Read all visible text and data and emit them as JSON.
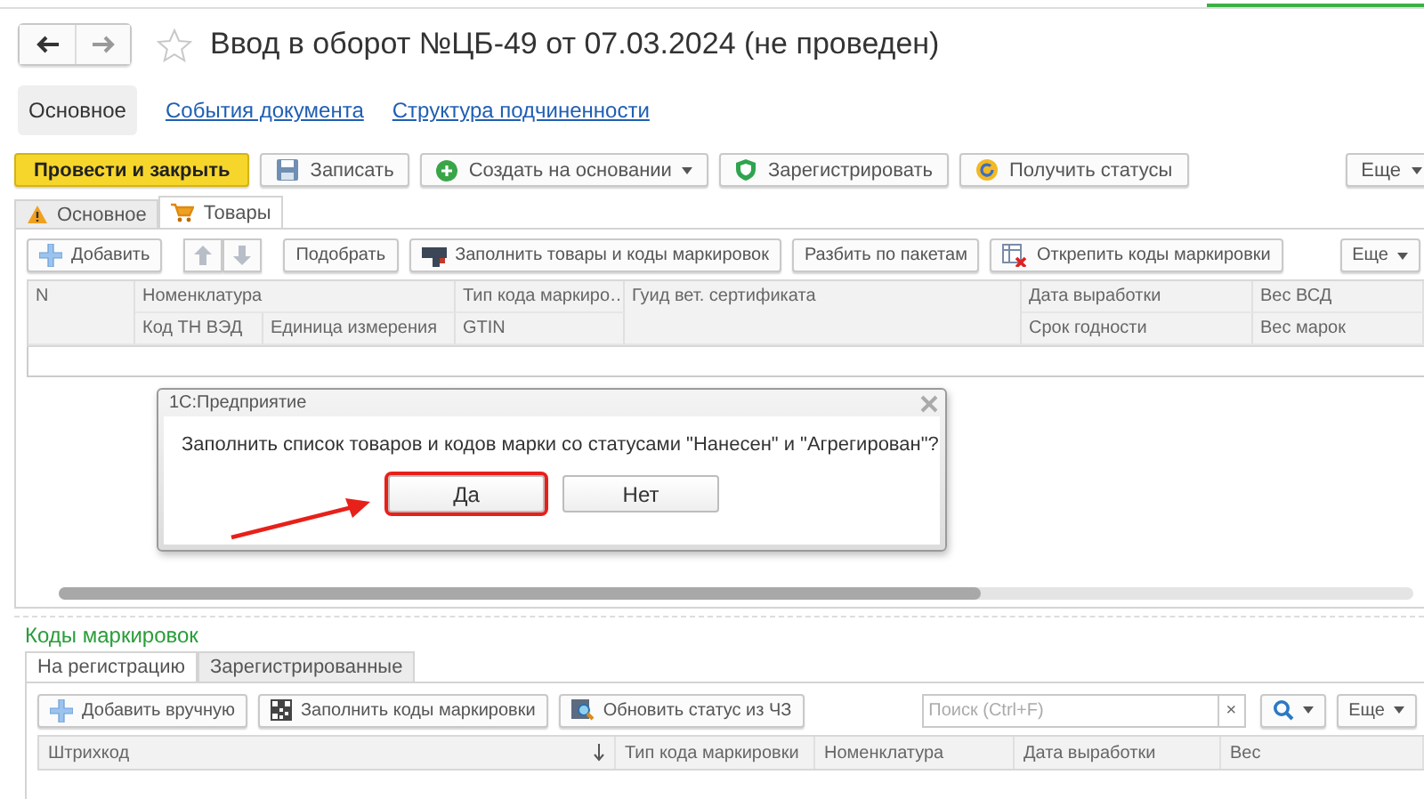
{
  "window": {
    "title": "Ввод в оборот №ЦБ-49 от 07.03.2024 (не проведен)"
  },
  "form_tabs": [
    {
      "label": "Основное",
      "selected": true
    },
    {
      "label": "События документа",
      "selected": false
    },
    {
      "label": "Структура подчиненности",
      "selected": false
    }
  ],
  "command_bar": [
    {
      "label": "Провести и закрыть",
      "kind": "primary"
    },
    {
      "label": "Записать",
      "kind": "save"
    },
    {
      "label": "Создать на основании",
      "kind": "create"
    },
    {
      "label": "Зарегистрировать",
      "kind": "register"
    },
    {
      "label": "Получить статусы",
      "kind": "status"
    },
    {
      "label": "Еще",
      "kind": "more"
    }
  ],
  "page_tabs": [
    {
      "label": "Основное",
      "kind": "warning",
      "selected": false
    },
    {
      "label": "Товары",
      "kind": "cart",
      "selected": true
    }
  ],
  "goods_toolbar": [
    {
      "label": "Добавить",
      "kind": "add"
    },
    {
      "kind": "updown"
    },
    {
      "label": "Подобрать",
      "kind": "plain"
    },
    {
      "label": "Заполнить товары и коды маркировок",
      "kind": "fill"
    },
    {
      "label": "Разбить по пакетам",
      "kind": "plain"
    },
    {
      "label": "Открепить коды маркировки",
      "kind": "unpin"
    },
    {
      "label": "Еще",
      "kind": "more"
    }
  ],
  "goods_table": {
    "columns_top": [
      "N",
      "Номенклатура",
      "Тип кода маркиро…",
      "Гуид вет. сертификата",
      "Дата выработки",
      "Вес ВСД"
    ],
    "columns_bottom": [
      "Код ТН ВЭД",
      "Единица измерения",
      "GTIN",
      "Срок годности",
      "Вес марок"
    ]
  },
  "codes_section": {
    "title": "Коды маркировок",
    "tabs": [
      {
        "label": "На регистрацию",
        "selected": true
      },
      {
        "label": "Зарегистрированные",
        "selected": false
      }
    ],
    "toolbar": [
      {
        "label": "Добавить вручную",
        "kind": "add"
      },
      {
        "label": "Заполнить коды маркировки",
        "kind": "qr"
      },
      {
        "label": "Обновить статус из ЧЗ",
        "kind": "refresh"
      }
    ],
    "search": {
      "placeholder": "Поиск (Ctrl+F)",
      "clear": "×"
    },
    "more": "Еще",
    "columns": [
      "Штрихкод",
      "Тип кода маркировки",
      "Номенклатура",
      "Дата выработки",
      "Вес"
    ]
  },
  "dialog": {
    "title": "1С:Предприятие",
    "message": "Заполнить список товаров и кодов марки со статусами \"Нанесен\" и \"Агрегирован\"?",
    "buttons": [
      {
        "label": "Да",
        "highlighted": true
      },
      {
        "label": "Нет",
        "highlighted": false
      }
    ]
  }
}
